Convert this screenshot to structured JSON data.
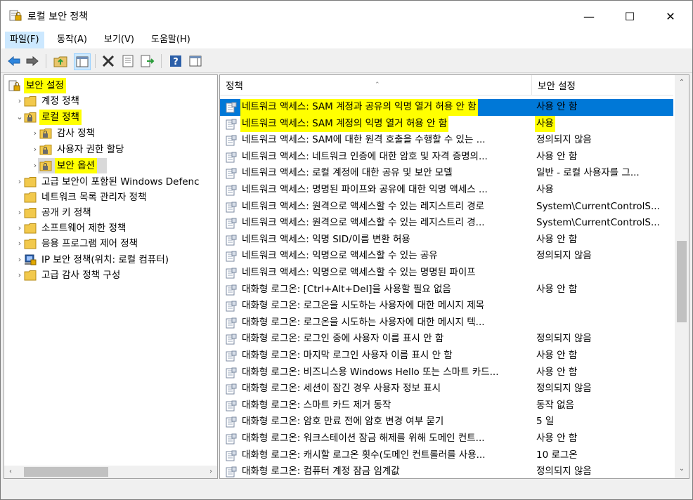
{
  "window": {
    "title": "로컬 보안 정책",
    "minimize": "—",
    "maximize": "☐",
    "close": "✕"
  },
  "menu": [
    "파일(F)",
    "동작(A)",
    "보기(V)",
    "도움말(H)"
  ],
  "toolbar": [
    "back-arrow-icon",
    "forward-arrow-icon",
    "up-folder-icon",
    "show-hide-tree-icon",
    "delete-icon",
    "properties-icon",
    "export-list-icon",
    "help-icon",
    "show-hide-action-pane-icon"
  ],
  "tree": [
    {
      "label": "보안 설정",
      "arrow": "",
      "highlight": true
    },
    {
      "label": "계정 정책",
      "arrow": "›",
      "highlight": false
    },
    {
      "label": "로컬 정책",
      "arrow": "⌄",
      "highlight": true
    },
    {
      "label": "감사 정책",
      "arrow": "›",
      "highlight": false
    },
    {
      "label": "사용자 권한 할당",
      "arrow": "›",
      "highlight": false
    },
    {
      "label": "보안 옵션",
      "arrow": "›",
      "highlight": true
    },
    {
      "label": "고급 보안이 포함된 Windows Defenc",
      "arrow": "›",
      "highlight": false
    },
    {
      "label": "네트워크 목록 관리자 정책",
      "arrow": "",
      "highlight": false
    },
    {
      "label": "공개 키 정책",
      "arrow": "›",
      "highlight": false
    },
    {
      "label": "소프트웨어 제한 정책",
      "arrow": "›",
      "highlight": false
    },
    {
      "label": "응용 프로그램 제어 정책",
      "arrow": "›",
      "highlight": false
    },
    {
      "label": "IP 보안 정책(위치: 로컬 컴퓨터)",
      "arrow": "›",
      "highlight": false
    },
    {
      "label": "고급 감사 정책 구성",
      "arrow": "›",
      "highlight": false
    }
  ],
  "columns": {
    "policy": "정책",
    "setting": "보안 설정"
  },
  "rows": [
    {
      "policy": "네트워크 액세스: SAM 계정과 공유의 익명 열거 허용 안 함",
      "setting": "사용 안 함"
    },
    {
      "policy": "네트워크 액세스: SAM 계정의 익명 열거 허용 안 함",
      "setting": "사용"
    },
    {
      "policy": "네트워크 액세스: SAM에 대한 원격 호출을 수행할 수 있는 ...",
      "setting": "정의되지 않음"
    },
    {
      "policy": "네트워크 액세스: 네트워크 인증에 대한 암호 및 자격 증명의...",
      "setting": "사용 안 함"
    },
    {
      "policy": "네트워크 액세스: 로컬 계정에 대한 공유 및 보안 모델",
      "setting": "일반 - 로컬 사용자를 그..."
    },
    {
      "policy": "네트워크 액세스: 명명된 파이프와 공유에 대한 익명 액세스 ...",
      "setting": "사용"
    },
    {
      "policy": "네트워크 액세스: 원격으로 액세스할 수 있는 레지스트리 경로",
      "setting": "System\\CurrentControlS..."
    },
    {
      "policy": "네트워크 액세스: 원격으로 액세스할 수 있는 레지스트리 경...",
      "setting": "System\\CurrentControlS..."
    },
    {
      "policy": "네트워크 액세스: 익명 SID/이름 변환 허용",
      "setting": "사용 안 함"
    },
    {
      "policy": "네트워크 액세스: 익명으로 액세스할 수 있는 공유",
      "setting": "정의되지 않음"
    },
    {
      "policy": "네트워크 액세스: 익명으로 액세스할 수 있는 명명된 파이프",
      "setting": ""
    },
    {
      "policy": "대화형 로그온: [Ctrl+Alt+Del]을 사용할 필요 없음",
      "setting": "사용 안 함"
    },
    {
      "policy": "대화형 로그온: 로그온을 시도하는 사용자에 대한 메시지 제목",
      "setting": ""
    },
    {
      "policy": "대화형 로그온: 로그온을 시도하는 사용자에 대한 메시지 텍...",
      "setting": ""
    },
    {
      "policy": "대화형 로그온: 로그인 중에 사용자 이름 표시 안 함",
      "setting": "정의되지 않음"
    },
    {
      "policy": "대화형 로그온: 마지막 로그인 사용자 이름 표시 안 함",
      "setting": "사용 안 함"
    },
    {
      "policy": "대화형 로그온: 비즈니스용 Windows Hello 또는 스마트 카드...",
      "setting": "사용 안 함"
    },
    {
      "policy": "대화형 로그온: 세션이 잠긴 경우 사용자 정보 표시",
      "setting": "정의되지 않음"
    },
    {
      "policy": "대화형 로그온: 스마트 카드 제거 동작",
      "setting": "동작 없음"
    },
    {
      "policy": "대화형 로그온: 암호 만료 전에 암호 변경 여부 묻기",
      "setting": "5 일"
    },
    {
      "policy": "대화형 로그온: 워크스테이션 잠금 해제를 위해 도메인 컨트...",
      "setting": "사용 안 함"
    },
    {
      "policy": "대화형 로그온: 캐시할 로그온 횟수(도메인 컨트롤러를 사용...",
      "setting": "10 로그온"
    },
    {
      "policy": "대화형 로그온: 컴퓨터 계정 잠금 임계값",
      "setting": "정의되지 않음"
    }
  ],
  "colors": {
    "highlight": "#ffff00",
    "selection": "#0078d7"
  }
}
